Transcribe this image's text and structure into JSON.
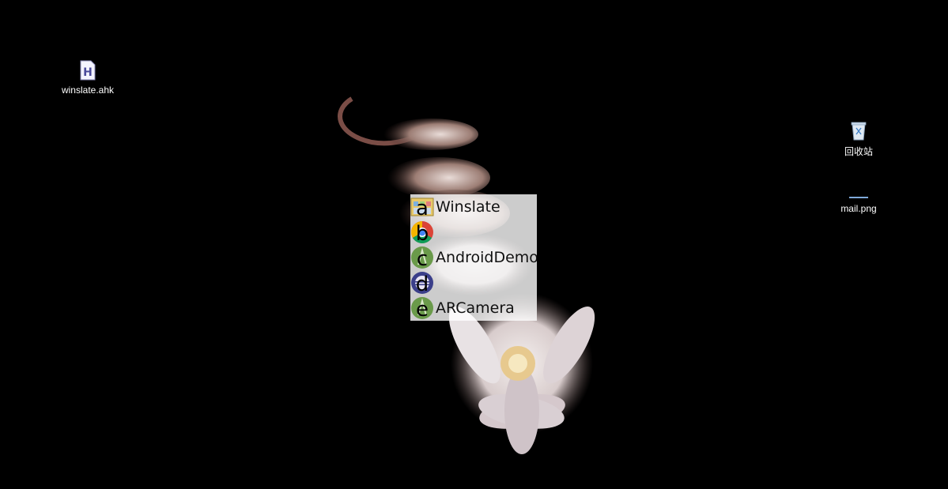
{
  "desktop": {
    "icons": [
      {
        "label": "winslate.ahk",
        "icon": "ahk-script-icon"
      },
      {
        "label": "回收站",
        "icon": "recycle-bin-icon"
      },
      {
        "label": "mail.png",
        "icon": "image-file-icon"
      }
    ]
  },
  "switcher": {
    "items": [
      {
        "key": "a",
        "title": "Winslate",
        "icon": "folder-app-icon"
      },
      {
        "key": "b",
        "title": "",
        "icon": "chrome-icon"
      },
      {
        "key": "c",
        "title": "AndroidDemo",
        "icon": "android-studio-icon"
      },
      {
        "key": "d",
        "title": "",
        "icon": "eclipse-icon"
      },
      {
        "key": "e",
        "title": "ARCamera",
        "icon": "android-studio-icon"
      }
    ]
  },
  "colors": {
    "background": "#000000",
    "switcher_bg": "#ffffffcc",
    "android_green": "#6a9a4a",
    "chrome_red": "#db4437",
    "chrome_yellow": "#f4b400",
    "chrome_green": "#0f9d58",
    "chrome_blue": "#4285f4",
    "eclipse_purple": "#3b3f8a"
  }
}
